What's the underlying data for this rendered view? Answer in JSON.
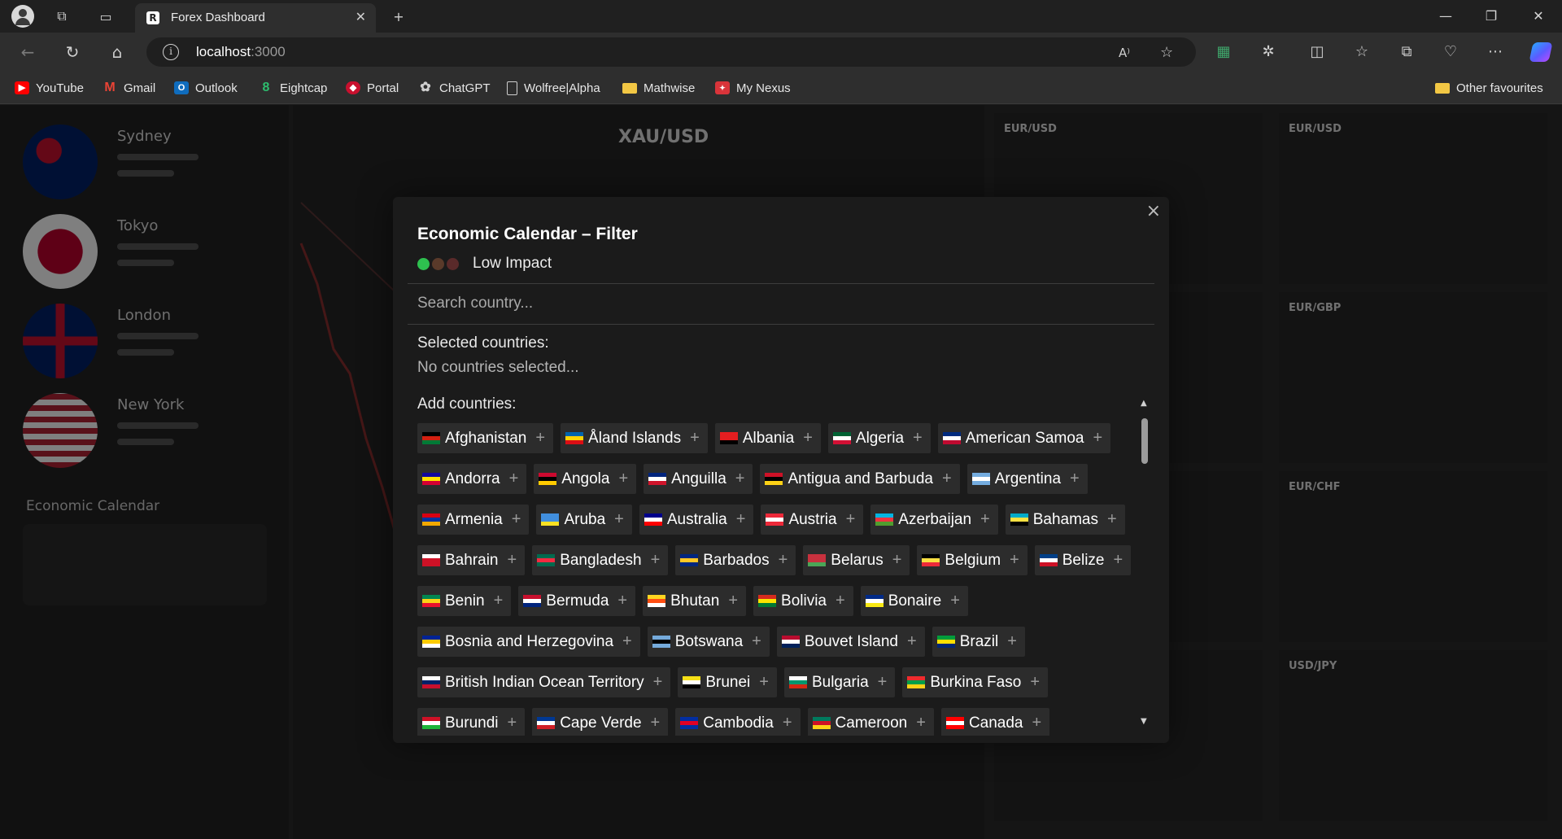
{
  "browser": {
    "tab_title": "Forex Dashboard",
    "url_host": "localhost",
    "url_port": ":3000",
    "bookmarks": [
      {
        "label": "YouTube",
        "icon": "youtube-icon",
        "color": "#ff0000"
      },
      {
        "label": "Gmail",
        "icon": "gmail-icon",
        "color": "#ea4335"
      },
      {
        "label": "Outlook",
        "icon": "outlook-icon",
        "color": "#0f6cbd"
      },
      {
        "label": "Eightcap",
        "icon": "eightcap-icon",
        "color": "#2dbd6e"
      },
      {
        "label": "Portal",
        "icon": "portal-icon",
        "color": "#c8102e"
      },
      {
        "label": "ChatGPT",
        "icon": "chatgpt-icon",
        "color": "#cfcfcf"
      },
      {
        "label": "Wolfree|Alpha",
        "icon": "page-icon",
        "color": "#cfcfcf"
      },
      {
        "label": "Mathwise",
        "icon": "folder-icon",
        "color": "#f2c744"
      },
      {
        "label": "My Nexus",
        "icon": "nexus-icon",
        "color": "#d9343a"
      }
    ],
    "other_favourites": "Other favourites"
  },
  "modal": {
    "title": "Economic Calendar – Filter",
    "impact_label": "Low Impact",
    "impact_dots": [
      "#2ec04f",
      "#5a3a2a",
      "#5a2a2a"
    ],
    "search_placeholder": "Search country...",
    "selected_label": "Selected countries:",
    "selected_empty": "No countries selected...",
    "add_label": "Add countries:",
    "plus": "+",
    "close": "×",
    "countries": [
      {
        "name": "Afghanistan",
        "flag": [
          "#000000",
          "#d32011",
          "#007a36"
        ]
      },
      {
        "name": "Åland Islands",
        "flag": [
          "#0064ad",
          "#ffd300",
          "#da0e15"
        ]
      },
      {
        "name": "Albania",
        "flag": [
          "#e41e20",
          "#e41e20",
          "#000000"
        ]
      },
      {
        "name": "Algeria",
        "flag": [
          "#006233",
          "#ffffff",
          "#d21034"
        ]
      },
      {
        "name": "American Samoa",
        "flag": [
          "#002b7f",
          "#ffffff",
          "#bf0a30"
        ]
      },
      {
        "name": "Andorra",
        "flag": [
          "#10069f",
          "#fedf00",
          "#d50032"
        ]
      },
      {
        "name": "Angola",
        "flag": [
          "#cc092f",
          "#000000",
          "#ffcb00"
        ]
      },
      {
        "name": "Anguilla",
        "flag": [
          "#00247d",
          "#ffffff",
          "#cf142b"
        ]
      },
      {
        "name": "Antigua and Barbuda",
        "flag": [
          "#ce1126",
          "#000000",
          "#fcd116"
        ]
      },
      {
        "name": "Argentina",
        "flag": [
          "#74acdf",
          "#ffffff",
          "#74acdf"
        ]
      },
      {
        "name": "Armenia",
        "flag": [
          "#d90012",
          "#0033a0",
          "#f2a800"
        ]
      },
      {
        "name": "Aruba",
        "flag": [
          "#418fde",
          "#418fde",
          "#fbe122"
        ]
      },
      {
        "name": "Australia",
        "flag": [
          "#00008b",
          "#ffffff",
          "#ff0000"
        ]
      },
      {
        "name": "Austria",
        "flag": [
          "#ed2939",
          "#ffffff",
          "#ed2939"
        ]
      },
      {
        "name": "Azerbaijan",
        "flag": [
          "#00b5e2",
          "#ef3340",
          "#509e2f"
        ]
      },
      {
        "name": "Bahamas",
        "flag": [
          "#00abc9",
          "#fae042",
          "#000000"
        ]
      },
      {
        "name": "Bahrain",
        "flag": [
          "#ffffff",
          "#ce1126",
          "#ce1126"
        ]
      },
      {
        "name": "Bangladesh",
        "flag": [
          "#006a4e",
          "#f42a41",
          "#006a4e"
        ]
      },
      {
        "name": "Barbados",
        "flag": [
          "#00267f",
          "#ffc726",
          "#00267f"
        ]
      },
      {
        "name": "Belarus",
        "flag": [
          "#c8313e",
          "#c8313e",
          "#4aa657"
        ]
      },
      {
        "name": "Belgium",
        "flag": [
          "#000000",
          "#fae042",
          "#ed2939"
        ]
      },
      {
        "name": "Belize",
        "flag": [
          "#003f87",
          "#ffffff",
          "#ce1126"
        ]
      },
      {
        "name": "Benin",
        "flag": [
          "#008751",
          "#fcd116",
          "#e8112d"
        ]
      },
      {
        "name": "Bermuda",
        "flag": [
          "#c8102e",
          "#ffffff",
          "#00247d"
        ]
      },
      {
        "name": "Bhutan",
        "flag": [
          "#ffd520",
          "#ff4e12",
          "#ffffff"
        ]
      },
      {
        "name": "Bolivia",
        "flag": [
          "#d52b1e",
          "#f9e300",
          "#007934"
        ]
      },
      {
        "name": "Bonaire",
        "flag": [
          "#012a87",
          "#ffffff",
          "#f9e814"
        ]
      },
      {
        "name": "Bosnia and Herzegovina",
        "flag": [
          "#002395",
          "#fecb00",
          "#ffffff"
        ]
      },
      {
        "name": "Botswana",
        "flag": [
          "#75aadb",
          "#000000",
          "#75aadb"
        ]
      },
      {
        "name": "Bouvet Island",
        "flag": [
          "#ba0c2f",
          "#ffffff",
          "#00205b"
        ]
      },
      {
        "name": "Brazil",
        "flag": [
          "#009c3b",
          "#ffdf00",
          "#002776"
        ]
      },
      {
        "name": "British Indian Ocean Territory",
        "flag": [
          "#ffffff",
          "#012169",
          "#c8102e"
        ]
      },
      {
        "name": "Brunei",
        "flag": [
          "#f7e017",
          "#ffffff",
          "#000000"
        ]
      },
      {
        "name": "Bulgaria",
        "flag": [
          "#ffffff",
          "#00966e",
          "#d62612"
        ]
      },
      {
        "name": "Burkina Faso",
        "flag": [
          "#ef2b2d",
          "#009e49",
          "#fcd116"
        ]
      },
      {
        "name": "Burundi",
        "flag": [
          "#ce1126",
          "#ffffff",
          "#1eb53a"
        ]
      },
      {
        "name": "Cape Verde",
        "flag": [
          "#003893",
          "#ffffff",
          "#cf2027"
        ]
      },
      {
        "name": "Cambodia",
        "flag": [
          "#032ea1",
          "#e00025",
          "#032ea1"
        ]
      },
      {
        "name": "Cameroon",
        "flag": [
          "#007a5e",
          "#ce1126",
          "#fcd116"
        ]
      },
      {
        "name": "Canada",
        "flag": [
          "#ff0000",
          "#ffffff",
          "#ff0000"
        ]
      }
    ]
  }
}
